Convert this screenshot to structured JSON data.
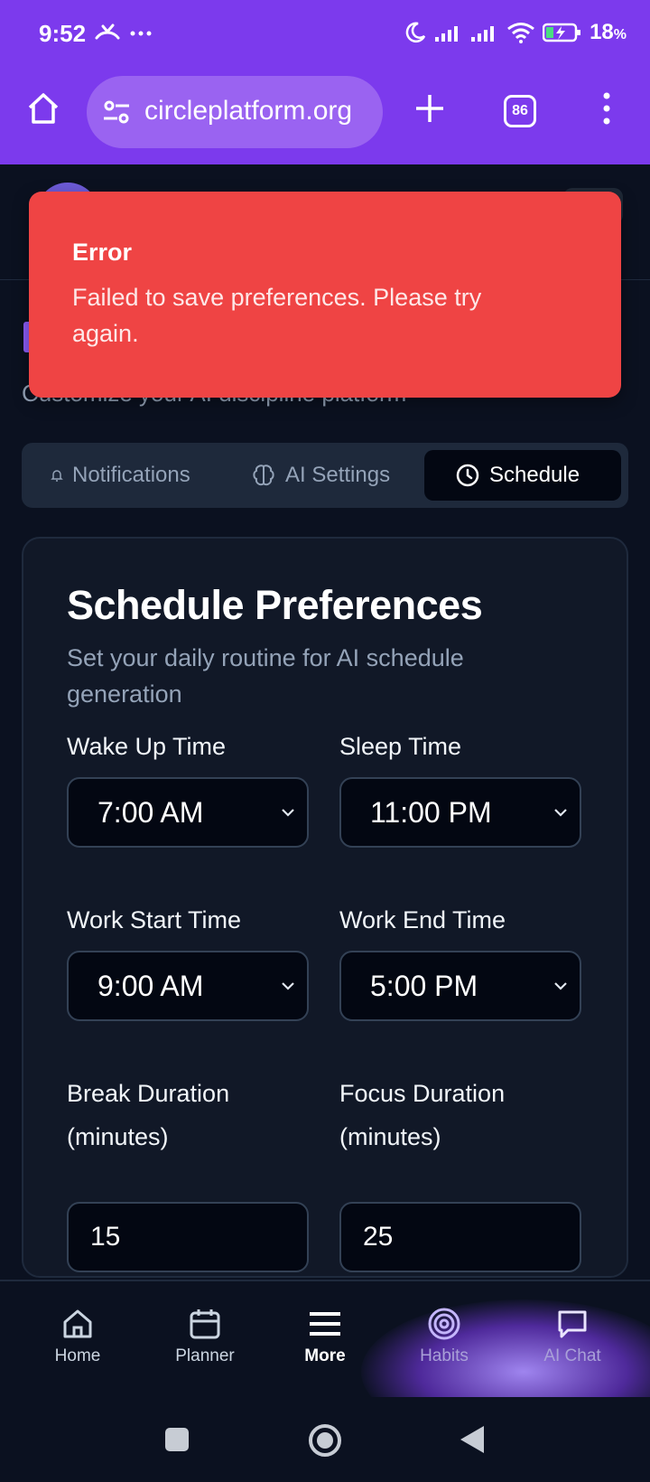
{
  "status_bar": {
    "time": "9:52",
    "left_icons": [
      "missed-call-icon",
      "more-dots-icon"
    ],
    "right_icons": [
      "moon-icon",
      "signal-icon",
      "signal-icon",
      "wifi-icon",
      "battery-charging-icon"
    ],
    "battery_percent": "18",
    "battery_unit": "%"
  },
  "browser": {
    "url": "circleplatform.org",
    "tab_count": "86"
  },
  "toast": {
    "title": "Error",
    "message": "Failed to save preferences. Please try again."
  },
  "page": {
    "subtitle": "Customize your AI discipline platform"
  },
  "tabs": [
    {
      "label": "Notifications",
      "icon": "bell-icon"
    },
    {
      "label": "AI Settings",
      "icon": "brain-icon"
    },
    {
      "label": "Schedule",
      "icon": "clock-icon",
      "active": true
    }
  ],
  "card": {
    "title": "Schedule Preferences",
    "description": "Set your daily routine for AI schedule generation",
    "fields": {
      "wake_up": {
        "label": "Wake Up Time",
        "value": "7:00 AM"
      },
      "sleep": {
        "label": "Sleep Time",
        "value": "11:00 PM"
      },
      "work_start": {
        "label": "Work Start Time",
        "value": "9:00 AM"
      },
      "work_end": {
        "label": "Work End Time",
        "value": "5:00 PM"
      },
      "break_duration": {
        "label": "Break Duration (minutes)",
        "value": "15"
      },
      "focus_duration": {
        "label": "Focus Duration (minutes)",
        "value": "25"
      }
    }
  },
  "bottom_nav": [
    {
      "label": "Home",
      "icon": "home-icon"
    },
    {
      "label": "Planner",
      "icon": "calendar-icon"
    },
    {
      "label": "More",
      "icon": "menu-icon",
      "active": true
    },
    {
      "label": "Habits",
      "icon": "target-icon"
    },
    {
      "label": "AI Chat",
      "icon": "chat-icon"
    }
  ],
  "colors": {
    "accent": "#7c3aed",
    "error": "#ef4444",
    "background": "#0b1120",
    "card": "#111827"
  }
}
